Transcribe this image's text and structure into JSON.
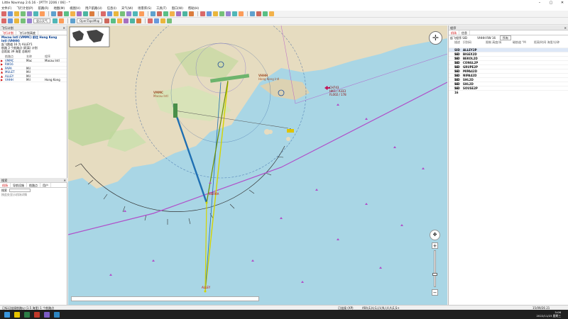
{
  "window": {
    "title": "Little Navmap 2.6.16 - [PTTY 2206 / 06] - *",
    "controls": [
      "–",
      "▢",
      "✕"
    ]
  },
  "menu": [
    "文件(F)",
    "飞行计划(P)",
    "航路(R)",
    "地图(M)",
    "视图(V)",
    "用户航路(U)",
    "信息(I)",
    "天气(W)",
    "场景库(S)",
    "工具(T)",
    "窗口(W)",
    "帮助(H)"
  ],
  "toolbar": {
    "selects": [
      "显示天气",
      "OpenTopoMap"
    ],
    "colors": [
      "#d23b3b",
      "#3a7bd5",
      "#e5a100",
      "#4caf50",
      "#7b5cc4",
      "#1aa3a3",
      "#ff7f27",
      "#b04fc9",
      "#2e86c1",
      "#c0392b",
      "#27ae60",
      "#f39c12",
      "#8e44ad",
      "#16a085",
      "#d35400",
      "#2c3e50"
    ]
  },
  "left": {
    "header": "飞行计划",
    "tabs": [
      "飞行计划",
      "飞行计划高度"
    ],
    "info": [
      "Macau Intl (VMMC) 前往 Hong Kong",
      "Intl (VHHH)",
      "起飞跑道 16 为 ALLEY1",
      "航路 3 个航路点 (距离) 计划",
      "总距离 39 海里  总耗时"
    ],
    "columns": [
      "",
      "航路点",
      "名称",
      "程序"
    ],
    "rows": [
      {
        "flag": "▶",
        "id": "VMMC",
        "name": "Mac",
        "proc": "Macau Intl"
      },
      {
        "flag": "▶",
        "id": "RW16",
        "name": "",
        "proc": ""
      },
      {
        "flag": "▲",
        "id": "PAPA",
        "name": "Mil",
        "proc": ""
      },
      {
        "flag": "▲",
        "id": "MULET",
        "name": "Mil",
        "proc": ""
      },
      {
        "flag": "▲",
        "id": "ALLEY",
        "name": "Mil",
        "proc": ""
      },
      {
        "flag": "▶",
        "id": "VHHH",
        "name": "Mil",
        "proc": "Hong Kong"
      }
    ],
    "lower": {
      "header": "搜索",
      "tabs": [
        "机场",
        "导航设施",
        "航路点",
        "用户"
      ],
      "search_label": "搜索",
      "search_placeholder": "",
      "hint": "按此处显示机场详情"
    }
  },
  "map": {
    "labels": [
      {
        "text": "VHHH",
        "kind": "airport"
      },
      {
        "text": "Hong Kong Intl",
        "kind": "airport"
      },
      {
        "text": "VMMC",
        "kind": "airport"
      },
      {
        "text": "Macau Intl",
        "kind": "airport"
      },
      {
        "text": "ALLEY",
        "kind": "waypoint"
      },
      {
        "text": "SIERRA",
        "kind": "waypoint"
      },
      {
        "text": "CH743",
        "kind": "flight"
      },
      {
        "text": "HKG / A333",
        "kind": "flight"
      },
      {
        "text": "FL002 / 178",
        "kind": "flight"
      }
    ],
    "colors": {
      "sea": "#a9d6e5",
      "land": "#e6dcc0",
      "route": "#1f6fb2",
      "approach": "#d4d400",
      "airspace": "#b04fc9"
    }
  },
  "right": {
    "header": "程序",
    "tabs": [
      "机场",
      "信息"
    ],
    "filter": "起飞程序 SID",
    "airport": "VHHH RW 16",
    "selector": "所有",
    "columns": [
      "描述",
      "识别码",
      "限制 高度/米",
      "磁航道 °M",
      "距离/时间 海里/分钟"
    ],
    "rows": [
      {
        "type": "SID 16",
        "id": "ALLEY2P"
      },
      {
        "type": "SID 16",
        "id": "BIGEX2D"
      },
      {
        "type": "SID 16",
        "id": "BEKOL2D"
      },
      {
        "type": "SID 16",
        "id": "CONGL2P"
      },
      {
        "type": "SID 16",
        "id": "GRUPE2P"
      },
      {
        "type": "SID 16",
        "id": "MIPA42D"
      },
      {
        "type": "SID 16",
        "id": "NIPA42D"
      },
      {
        "type": "SID 16",
        "id": "SHL2D"
      },
      {
        "type": "SID 16",
        "id": "SHL2D"
      },
      {
        "type": "SID 16",
        "id": "SOUSE2P"
      }
    ]
  },
  "statusbar": {
    "left": "已标记连接航路以 (1.5 海里) 1 个航路点",
    "mid": "已连接 (XP)",
    "coords": "ARA,E,H,G,I,V,N,I,V,A,E,S+",
    "right": "15/09/26 21"
  },
  "taskbar": {
    "time": "5:06",
    "date": "2022/11/23 星期三"
  }
}
